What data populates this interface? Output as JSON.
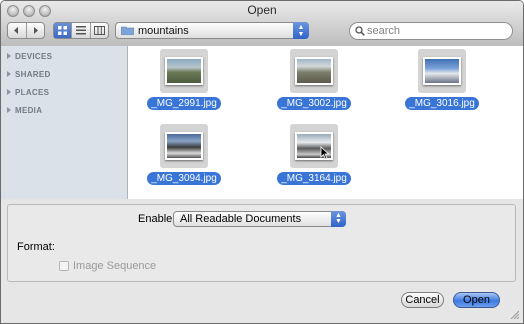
{
  "window": {
    "title": "Open"
  },
  "toolbar": {
    "back_icon": "left-arrow-icon",
    "forward_icon": "right-arrow-icon",
    "view_modes": [
      "icon-view",
      "list-view",
      "column-view"
    ],
    "active_view": "icon-view",
    "location": "mountains",
    "search_placeholder": "search"
  },
  "sidebar": {
    "sections": [
      {
        "label": "DEVICES"
      },
      {
        "label": "SHARED"
      },
      {
        "label": "PLACES"
      },
      {
        "label": "MEDIA"
      }
    ]
  },
  "files": [
    {
      "name": "_MG_2991.jpg",
      "selected": true
    },
    {
      "name": "_MG_3002.jpg",
      "selected": true
    },
    {
      "name": "_MG_3016.jpg",
      "selected": true
    },
    {
      "name": "_MG_3094.jpg",
      "selected": true
    },
    {
      "name": "_MG_3164.jpg",
      "selected": true
    }
  ],
  "options": {
    "enable_label": "Enable:",
    "enable_value": "All Readable Documents",
    "format_label": "Format:",
    "image_sequence_label": "Image Sequence",
    "image_sequence_checked": false
  },
  "buttons": {
    "cancel": "Cancel",
    "open": "Open"
  },
  "colors": {
    "selection": "#3875d7",
    "sidebar_bg": "#dbe1e8"
  }
}
